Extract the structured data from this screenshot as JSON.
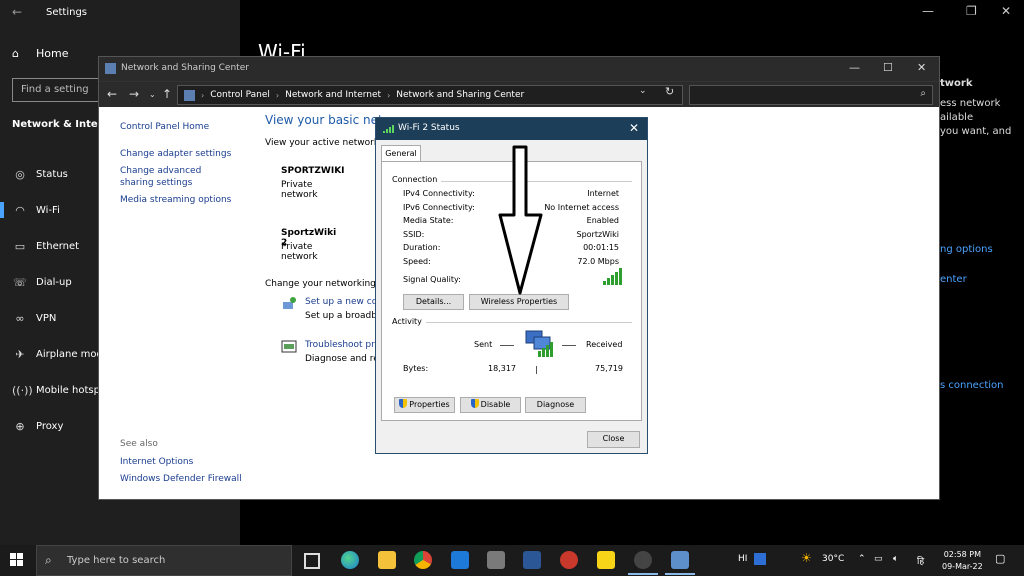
{
  "settings": {
    "title": "Settings",
    "home": "Home",
    "search_placeholder": "Find a setting",
    "section": "Network & Interne",
    "heading": "Wi-Fi",
    "nav": [
      {
        "label": "Status",
        "icon": "globe-icon"
      },
      {
        "label": "Wi-Fi",
        "icon": "wifi-icon"
      },
      {
        "label": "Ethernet",
        "icon": "ethernet-icon"
      },
      {
        "label": "Dial-up",
        "icon": "dialup-icon"
      },
      {
        "label": "VPN",
        "icon": "vpn-icon"
      },
      {
        "label": "Airplane mod",
        "icon": "airplane-icon"
      },
      {
        "label": "Mobile hotsp",
        "icon": "hotspot-icon"
      },
      {
        "label": "Proxy",
        "icon": "proxy-icon"
      }
    ],
    "right_text": [
      "twork",
      "ess network",
      "ailable",
      "you want, and"
    ],
    "right_links": [
      "ng options",
      "enter",
      "s connection"
    ]
  },
  "nsc": {
    "title": "Network and Sharing Center",
    "breadcrumbs": [
      "Control Panel",
      "Network and Internet",
      "Network and Sharing Center"
    ],
    "left_links": [
      "Control Panel Home",
      "Change adapter settings",
      "Change advanced sharing settings",
      "Media streaming options"
    ],
    "see_also_label": "See also",
    "see_also_links": [
      "Internet Options",
      "Windows Defender Firewall"
    ],
    "heading": "View your basic netw",
    "active_networks_label": "View your active networks",
    "networks": [
      {
        "name": "SPORTZWIKI",
        "type": "Private network"
      },
      {
        "name": "SportzWiki 2",
        "type": "Private network"
      }
    ],
    "change_label": "Change your networking se",
    "tasks": [
      {
        "link": "Set up a new conr",
        "desc": "Set up a broadban"
      },
      {
        "link": "Troubleshoot prob",
        "desc": "Diagnose and rep"
      }
    ]
  },
  "dialog": {
    "title": "Wi-Fi 2 Status",
    "tab": "General",
    "connection_label": "Connection",
    "fields": [
      {
        "key": "IPv4 Connectivity:",
        "value": "Internet"
      },
      {
        "key": "IPv6 Connectivity:",
        "value": "No Internet access"
      },
      {
        "key": "Media State:",
        "value": "Enabled"
      },
      {
        "key": "SSID:",
        "value": "SportzWiki"
      },
      {
        "key": "Duration:",
        "value": "00:01:15"
      },
      {
        "key": "Speed:",
        "value": "72.0 Mbps"
      }
    ],
    "signal_label": "Signal Quality:",
    "details_button": "Details...",
    "wireless_button": "Wireless Properties",
    "activity_label": "Activity",
    "sent_label": "Sent",
    "received_label": "Received",
    "bytes_label": "Bytes:",
    "bytes_sent": "18,317",
    "bytes_received": "75,719",
    "properties_button": "Properties",
    "disable_button": "Disable",
    "diagnose_button": "Diagnose",
    "close_button": "Close"
  },
  "taskbar": {
    "search_placeholder": "Type here to search",
    "weather": "30°C",
    "lang": "HI",
    "time": "02:58 PM",
    "date": "09-Mar-22"
  }
}
